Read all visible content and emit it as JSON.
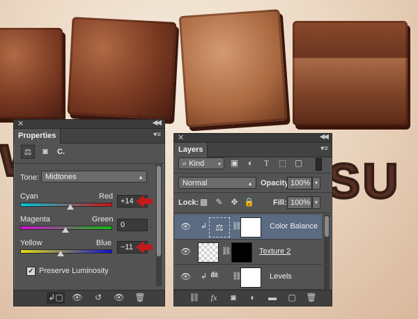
{
  "properties": {
    "tab_title": "Properties",
    "adjustment_label": "C.",
    "tone_label": "Tone:",
    "tone_value": "Midtones",
    "sliders": [
      {
        "left": "Cyan",
        "right": "Red",
        "value": "+14",
        "fraction": 0.57
      },
      {
        "left": "Magenta",
        "right": "Green",
        "value": "0",
        "fraction": 0.5
      },
      {
        "left": "Yellow",
        "right": "Blue",
        "value": "−11",
        "fraction": 0.45
      }
    ],
    "preserve_luminosity_label": "Preserve Luminosity",
    "preserve_luminosity_checked": true
  },
  "layers": {
    "tab_title": "Layers",
    "filter_value": "Kind",
    "blend_mode": "Normal",
    "opacity_label": "Opacity:",
    "opacity_value": "100%",
    "lock_label": "Lock:",
    "fill_label": "Fill:",
    "fill_value": "100%",
    "rows": [
      {
        "name": "Color Balance",
        "selected": true
      },
      {
        "name": "Texture 2",
        "selected": false
      },
      {
        "name": "Levels",
        "selected": false
      }
    ]
  },
  "colors": {
    "accent_arrow": "#c21a1a",
    "panel_bg": "#535353",
    "selected_row": "#5a6b82"
  }
}
